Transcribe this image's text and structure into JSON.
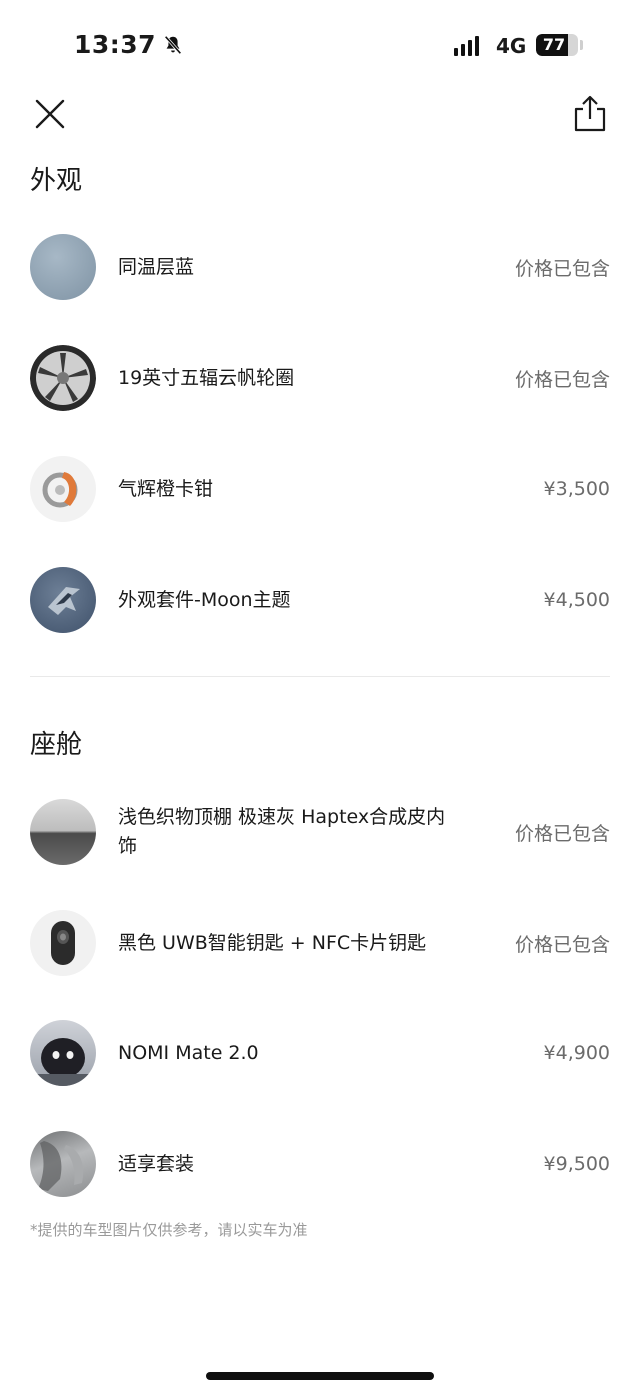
{
  "status_bar": {
    "time": "13:37",
    "network": "4G",
    "battery": "77",
    "battery_level": 0.77,
    "icons": [
      "bell-slash-icon",
      "signal-icon",
      "battery-icon"
    ]
  },
  "nav": {
    "icons": [
      "close-icon",
      "share-icon"
    ]
  },
  "exterior": {
    "title": "外观",
    "items": [
      {
        "name": "同温层蓝",
        "price": "价格已包含",
        "color": "#8ea1b1"
      },
      {
        "name": "19英寸五辐云帆轮圈",
        "price": "价格已包含",
        "color": "#4a4a4a"
      },
      {
        "name": "气辉橙卡钳",
        "price": "¥3,500",
        "color": "#e07a3a"
      },
      {
        "name": "外观套件-Moon主题",
        "price": "¥4,500",
        "color": "#4d6079"
      }
    ]
  },
  "cabin": {
    "title": "座舱",
    "items": [
      {
        "name": "浅色织物顶棚 极速灰 Haptex合成皮内饰",
        "price": "价格已包含",
        "color": "#9a9a9a"
      },
      {
        "name": "黑色 UWB智能钥匙 + NFC卡片钥匙",
        "price": "价格已包含",
        "color": "#2b2b2b"
      },
      {
        "name": "NOMI Mate 2.0",
        "price": "¥4,900",
        "color": "#2d2d34"
      },
      {
        "name": "适享套装",
        "price": "¥9,500",
        "color": "#8f9193"
      }
    ]
  },
  "footnote": "*提供的车型图片仅供参考，请以实车为准",
  "colors": {
    "price_text": "#6b6b6b",
    "footnote": "#9a9a9a",
    "divider": "#e9e9e9"
  }
}
